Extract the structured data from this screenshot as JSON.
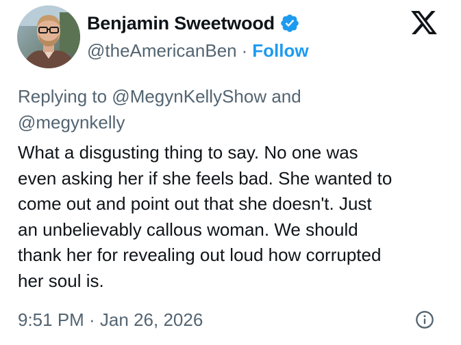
{
  "author": {
    "name": "Benjamin Sweetwood",
    "handle": "@theAmericanBen",
    "separator": "·",
    "follow_label": "Follow",
    "verified_icon": "verified-badge-icon",
    "avatar_icon": "profile-photo"
  },
  "brand": {
    "logo_icon": "x-logo-icon"
  },
  "reply": {
    "line1": "Replying to @MegynKellyShow and",
    "line2": "@megynkelly"
  },
  "body": {
    "lines": [
      "What a disgusting thing to say. No one was",
      "even asking her if she feels bad. She wanted to",
      "come out and point out that she doesn't. Just",
      "an unbelievably callous woman. We should",
      "thank her for revealing out loud how corrupted",
      "her soul is."
    ]
  },
  "footer": {
    "timestamp": "9:51 PM · Jan 26, 2026",
    "info_icon": "info-icon"
  },
  "colors": {
    "text": "#0f1419",
    "secondary": "#536471",
    "link": "#1d9bf0",
    "background": "#ffffff"
  }
}
